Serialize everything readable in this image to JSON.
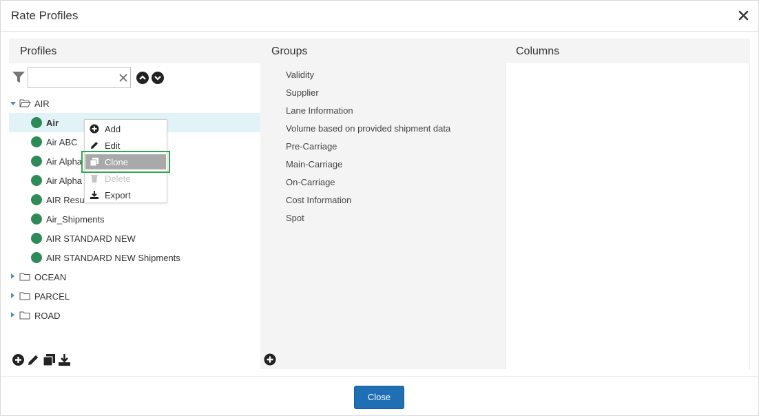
{
  "dialog": {
    "title": "Rate Profiles",
    "close_button_label": "Close"
  },
  "columns": {
    "profiles": "Profiles",
    "groups": "Groups",
    "columns": "Columns"
  },
  "filter": {
    "value": "",
    "placeholder": ""
  },
  "tree": {
    "folders": [
      {
        "label": "AIR",
        "expanded": true
      },
      {
        "label": "OCEAN",
        "expanded": false
      },
      {
        "label": "PARCEL",
        "expanded": false
      },
      {
        "label": "ROAD",
        "expanded": false
      }
    ],
    "air_items": [
      {
        "label": "Air",
        "selected": true
      },
      {
        "label": "Air ABC"
      },
      {
        "label": "Air Alpha"
      },
      {
        "label": "Air Alpha"
      },
      {
        "label": "AIR Resul"
      },
      {
        "label": "Air_Shipments"
      },
      {
        "label": "AIR STANDARD NEW"
      },
      {
        "label": "AIR STANDARD NEW Shipments"
      }
    ],
    "status_color": "#2e8b57"
  },
  "context_menu": {
    "items": [
      {
        "label": "Add",
        "icon": "plus-circle-icon"
      },
      {
        "label": "Edit",
        "icon": "pencil-icon"
      },
      {
        "label": "Clone",
        "icon": "clone-icon",
        "highlighted": true
      },
      {
        "label": "Delete",
        "icon": "trash-icon",
        "disabled": true
      },
      {
        "label": "Export",
        "icon": "download-icon"
      }
    ]
  },
  "groups": {
    "items": [
      "Validity",
      "Supplier",
      "Lane Information",
      "Volume based on provided shipment data",
      "Pre-Carriage",
      "Main-Carriage",
      "On-Carriage",
      "Cost Information",
      "Spot"
    ]
  },
  "colors": {
    "primary_button": "#1f6fb4",
    "selection_bg": "#e2f3f7",
    "highlight_outline": "#2eaa4e",
    "caret": "#4a90c2"
  }
}
